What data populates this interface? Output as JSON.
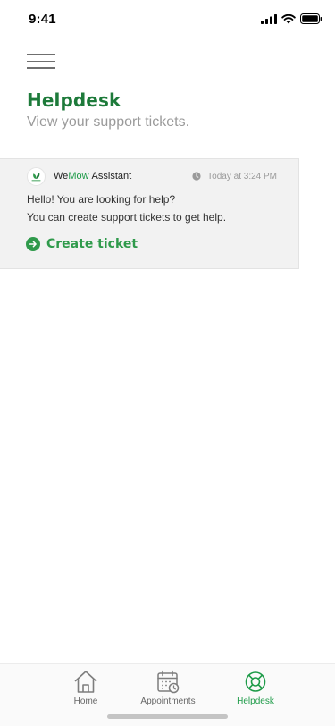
{
  "status_bar": {
    "time": "9:41"
  },
  "header": {
    "title": "Helpdesk",
    "subtitle": "View your support tickets."
  },
  "ticket": {
    "brand_we": "We",
    "brand_mow": "Mow",
    "assistant_label": "Assistant",
    "timestamp": "Today at 3:24 PM",
    "message_line1": "Hello! You are looking for help?",
    "message_line2": "You can create support tickets to get help.",
    "action_label": "Create ticket"
  },
  "tabs": [
    {
      "label": "Home",
      "icon": "home-icon",
      "active": false
    },
    {
      "label": "Appointments",
      "icon": "calendar-clock-icon",
      "active": false
    },
    {
      "label": "Helpdesk",
      "icon": "lifebuoy-icon",
      "active": true
    }
  ],
  "colors": {
    "brand_green": "#1d7a3a",
    "accent_green": "#2f9a4b",
    "muted_text": "#9a9a9a",
    "card_background": "#f2f2f2"
  }
}
